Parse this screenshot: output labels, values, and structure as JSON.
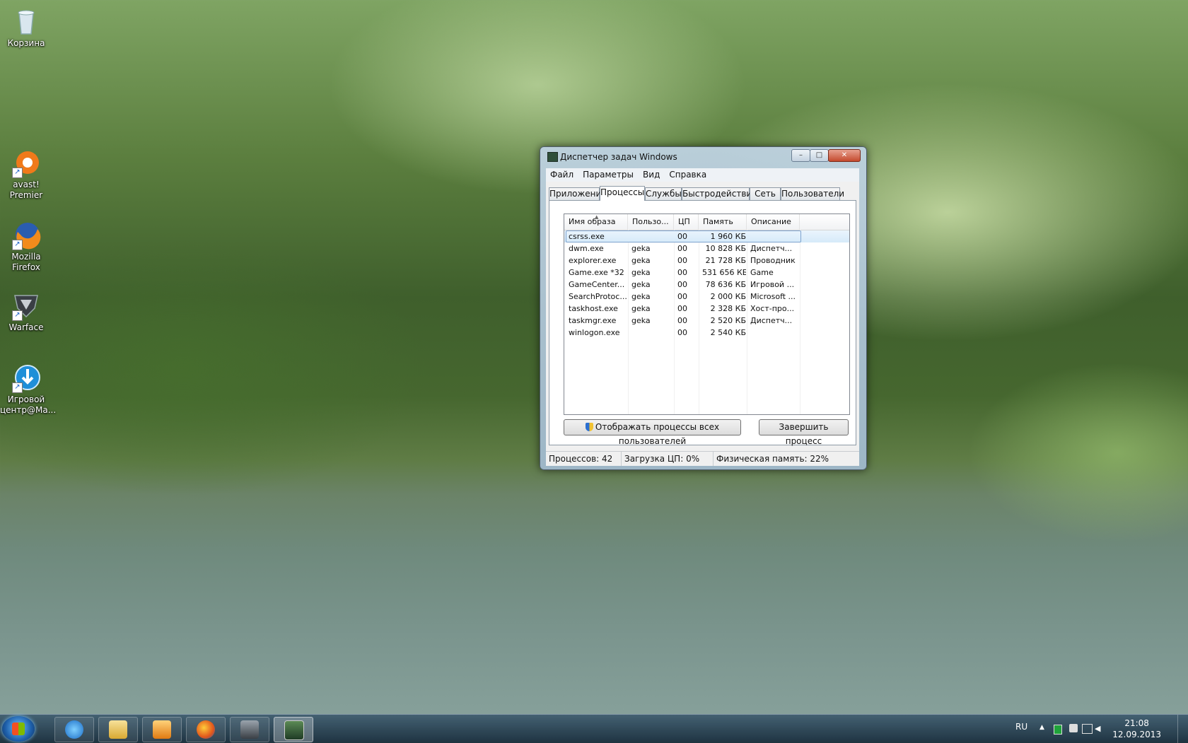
{
  "desktop": {
    "icons": [
      {
        "label": "Корзина"
      },
      {
        "label": "avast! Premier"
      },
      {
        "label": "Mozilla Firefox"
      },
      {
        "label": "Warface"
      },
      {
        "label": "Игровой центр@Ma..."
      }
    ]
  },
  "window": {
    "title": "Диспетчер задач Windows",
    "controls": {
      "minimize": "–",
      "maximize": "□",
      "close": "✕"
    },
    "menu": [
      "Файл",
      "Параметры",
      "Вид",
      "Справка"
    ],
    "tabs": [
      "Приложения",
      "Процессы",
      "Службы",
      "Быстродействие",
      "Сеть",
      "Пользователи"
    ],
    "active_tab": "Процессы",
    "columns": [
      "Имя образа",
      "Пользо...",
      "ЦП",
      "Память (...",
      "Описание"
    ],
    "rows": [
      {
        "name": "csrss.exe",
        "user": "",
        "cpu": "00",
        "mem": "1 960 КБ",
        "desc": ""
      },
      {
        "name": "dwm.exe",
        "user": "geka",
        "cpu": "00",
        "mem": "10 828 КБ",
        "desc": "Диспетч..."
      },
      {
        "name": "explorer.exe",
        "user": "geka",
        "cpu": "00",
        "mem": "21 728 КБ",
        "desc": "Проводник"
      },
      {
        "name": "Game.exe *32",
        "user": "geka",
        "cpu": "00",
        "mem": "531 656 КБ",
        "desc": "Game"
      },
      {
        "name": "GameCenter...",
        "user": "geka",
        "cpu": "00",
        "mem": "78 636 КБ",
        "desc": "Игровой ..."
      },
      {
        "name": "SearchProtoc...",
        "user": "geka",
        "cpu": "00",
        "mem": "2 000 КБ",
        "desc": "Microsoft ..."
      },
      {
        "name": "taskhost.exe",
        "user": "geka",
        "cpu": "00",
        "mem": "2 328 КБ",
        "desc": "Хост-про..."
      },
      {
        "name": "taskmgr.exe",
        "user": "geka",
        "cpu": "00",
        "mem": "2 520 КБ",
        "desc": "Диспетч..."
      },
      {
        "name": "winlogon.exe",
        "user": "",
        "cpu": "00",
        "mem": "2 540 КБ",
        "desc": ""
      }
    ],
    "buttons": {
      "show_all": "Отображать процессы всех пользователей",
      "end_process": "Завершить процесс"
    },
    "status": {
      "processes": "Процессов: 42",
      "cpu": "Загрузка ЦП: 0%",
      "memory": "Физическая память: 22%"
    }
  },
  "taskbar": {
    "language": "RU",
    "time": "21:08",
    "date": "12.09.2013",
    "pinned_icons": [
      "internet-explorer-icon",
      "explorer-folder-icon",
      "media-player-icon",
      "firefox-icon",
      "warface-icon",
      "task-manager-icon"
    ]
  },
  "colors": {
    "selection": "#d6eaf9",
    "close_button": "#c54a2e",
    "taskbar": "#1d3444"
  }
}
